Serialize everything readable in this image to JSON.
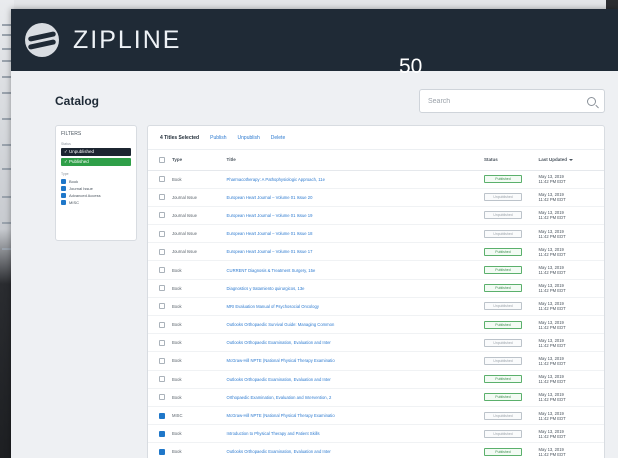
{
  "app": {
    "brand": "ZIPLINE",
    "counter": "50"
  },
  "page": {
    "title": "Catalog"
  },
  "search": {
    "placeholder": "Search"
  },
  "filters": {
    "title": "FILTERS",
    "status_label": "Status",
    "status_chips": [
      "✓ Unpublished",
      "✓ Published"
    ],
    "type_label": "Type",
    "types": [
      "Book",
      "Journal Issue",
      "Advanced Access",
      "MISC"
    ]
  },
  "tabs": [
    "4 Titles Selected",
    "Publish",
    "Unpublish",
    "Delete"
  ],
  "table": {
    "headers": {
      "type": "Type",
      "title": "Title",
      "status": "Status",
      "updated": "Last Updated"
    },
    "rows": [
      {
        "checked": false,
        "type": "Book",
        "title": "Pharmacotherapy: A Pathophysiologic Approach, 11e",
        "status": "Published",
        "date": "May 13, 2019",
        "time": "11:42 PM EDT"
      },
      {
        "checked": false,
        "type": "Journal Issue",
        "title": "European Heart Journal – Volume 01 Issue 20",
        "status": "Unpublished",
        "date": "May 13, 2019",
        "time": "11:42 PM EDT"
      },
      {
        "checked": false,
        "type": "Journal Issue",
        "title": "European Heart Journal – Volume 01 Issue 19",
        "status": "Unpublished",
        "date": "May 13, 2019",
        "time": "11:42 PM EDT"
      },
      {
        "checked": false,
        "type": "Journal Issue",
        "title": "European Heart Journal – Volume 01 Issue 18",
        "status": "Unpublished",
        "date": "May 13, 2019",
        "time": "11:42 PM EDT"
      },
      {
        "checked": false,
        "type": "Journal Issue",
        "title": "European Heart Journal – Volume 01 Issue 17",
        "status": "Published",
        "date": "May 13, 2019",
        "time": "11:42 PM EDT"
      },
      {
        "checked": false,
        "type": "Book",
        "title": "CURRENT Diagnosis & Treatment Surgery, 15e",
        "status": "Published",
        "date": "May 13, 2019",
        "time": "11:42 PM EDT"
      },
      {
        "checked": false,
        "type": "Book",
        "title": "Diagnostics y tratamiento quirurgicos, 13e",
        "status": "Published",
        "date": "May 13, 2019",
        "time": "11:42 PM EDT"
      },
      {
        "checked": false,
        "type": "Book",
        "title": "MRI Evaluation Manual of Psychosocial Oncology",
        "status": "Unpublished",
        "date": "May 13, 2019",
        "time": "11:42 PM EDT"
      },
      {
        "checked": false,
        "type": "Book",
        "title": "Outlooks Orthopaedic Survival Guide: Managing Common",
        "status": "Published",
        "date": "May 13, 2019",
        "time": "11:42 PM EDT"
      },
      {
        "checked": false,
        "type": "Book",
        "title": "Outlooks Orthopaedic Examination, Evaluation and Inter",
        "status": "Unpublished",
        "date": "May 13, 2019",
        "time": "11:42 PM EDT"
      },
      {
        "checked": false,
        "type": "Book",
        "title": "McGraw-Hill NPTE (National Physical Therapy Examinatio",
        "status": "Unpublished",
        "date": "May 13, 2019",
        "time": "11:42 PM EDT"
      },
      {
        "checked": false,
        "type": "Book",
        "title": "Outlooks Orthopaedic Examination, Evaluation and Inter",
        "status": "Published",
        "date": "May 13, 2019",
        "time": "11:42 PM EDT"
      },
      {
        "checked": false,
        "type": "Book",
        "title": "Orthopaedic Examination, Evaluation and Intervention, 2",
        "status": "Published",
        "date": "May 13, 2019",
        "time": "11:42 PM EDT"
      },
      {
        "checked": true,
        "type": "MISC",
        "title": "McGraw-Hill NPTE (National Physical Therapy Examinatio",
        "status": "Unpublished",
        "date": "May 13, 2019",
        "time": "11:42 PM EDT"
      },
      {
        "checked": true,
        "type": "Book",
        "title": "Introduction to Physical Therapy and Patient Skills",
        "status": "Unpublished",
        "date": "May 13, 2019",
        "time": "11:42 PM EDT"
      },
      {
        "checked": true,
        "type": "Book",
        "title": "Outlooks Orthopaedic Examination, Evaluation and Inter",
        "status": "Published",
        "date": "May 13, 2019",
        "time": "11:42 PM EDT"
      }
    ]
  }
}
